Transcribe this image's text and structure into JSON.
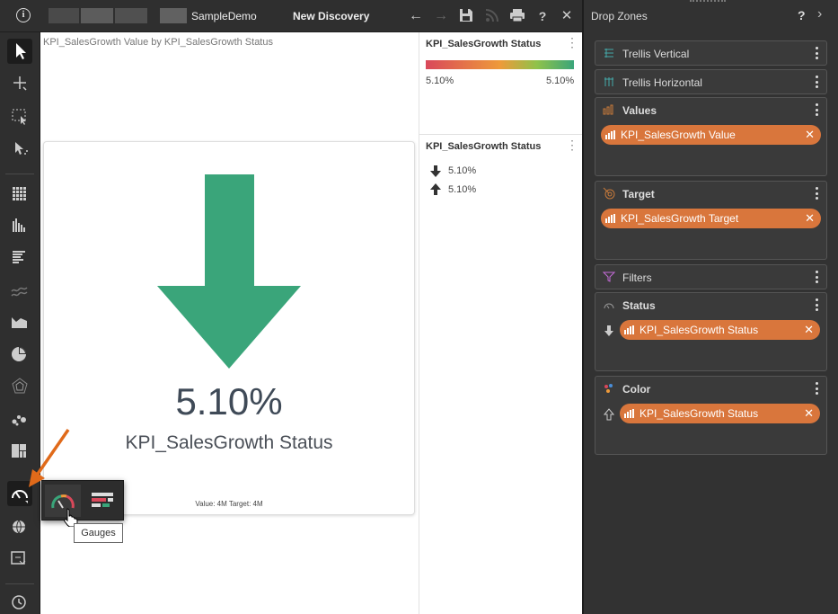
{
  "topbar": {
    "app_name": "SampleDemo",
    "discovery_title": "New Discovery",
    "info_glyph": "i",
    "icons": [
      "back-arrow-icon",
      "forward-arrow-icon",
      "save-icon",
      "rss-icon",
      "print-icon",
      "help-icon",
      "close-icon"
    ],
    "help_glyph": "?",
    "close_glyph": "✕",
    "back_glyph": "←",
    "forward_glyph": "→"
  },
  "toolbar": {
    "items": [
      "pointer-tool",
      "move-tool",
      "select-region-tool",
      "pointer-select-tool",
      "grid-chart",
      "column-chart",
      "bar-chart",
      "line-chart",
      "area-chart",
      "pie-chart",
      "radar-chart",
      "scatter-chart",
      "treemap-chart",
      "gauge-chart",
      "map-chart",
      "custom-chart",
      "settings"
    ]
  },
  "visual": {
    "title": "KPI_SalesGrowth Value by KPI_SalesGrowth Status",
    "kpi_value": "5.10%",
    "kpi_label": "KPI_SalesGrowth Status",
    "footer": "Value: 4M Target: 4M",
    "arrow_color": "#3aa57a",
    "direction": "down"
  },
  "legends": {
    "color_legend": {
      "title": "KPI_SalesGrowth Status",
      "min": "5.10%",
      "max": "5.10%",
      "gradient": [
        "#d9485a",
        "#ee9a3a",
        "#8fc24a",
        "#3aa57a"
      ]
    },
    "status_legend": {
      "title": "KPI_SalesGrowth Status",
      "items": [
        {
          "icon": "arrow-down-icon",
          "label": "5.10%"
        },
        {
          "icon": "arrow-up-icon",
          "label": "5.10%"
        }
      ]
    }
  },
  "gauges_popup": {
    "tooltip": "Gauges"
  },
  "drop_zones": {
    "title": "Drop Zones",
    "help_glyph": "?",
    "collapse_glyph": "›",
    "zones": [
      {
        "label": "Trellis Vertical",
        "icon": "trellis-vertical-icon"
      },
      {
        "label": "Trellis Horizontal",
        "icon": "trellis-horizontal-icon"
      },
      {
        "label": "Values",
        "icon": "values-icon",
        "chip": "KPI_SalesGrowth Value"
      },
      {
        "label": "Target",
        "icon": "target-icon",
        "chip": "KPI_SalesGrowth Target"
      },
      {
        "label": "Filters",
        "icon": "filter-icon"
      },
      {
        "label": "Status",
        "icon": "status-gauge-icon",
        "chip": "KPI_SalesGrowth Status"
      },
      {
        "label": "Color",
        "icon": "color-palette-icon",
        "chip": "KPI_SalesGrowth Status"
      }
    ],
    "chip_close": "✕",
    "colors": {
      "chip": "#d9763c",
      "panel": "#323232",
      "zone": "#3a3a3a"
    }
  }
}
